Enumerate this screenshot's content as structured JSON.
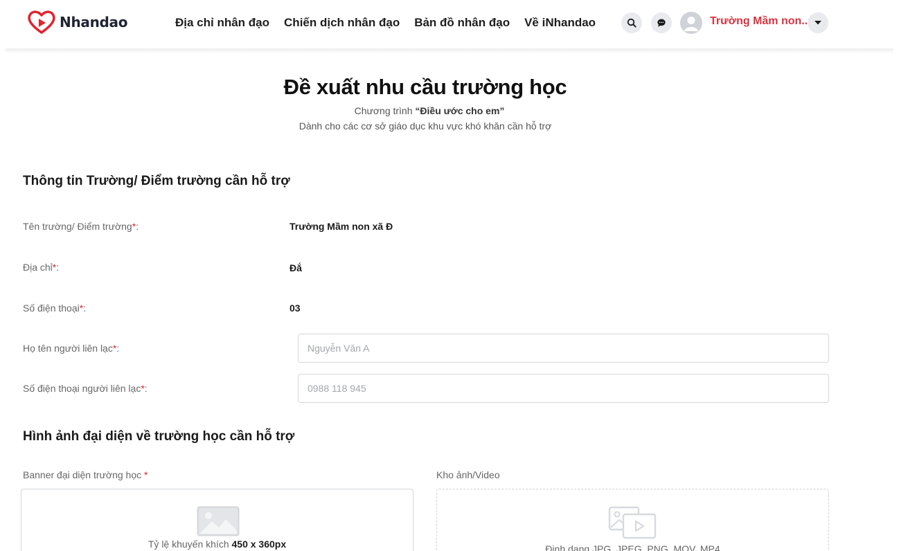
{
  "brand": {
    "name": "Nhandao",
    "logo_color": "#e0242f"
  },
  "nav": [
    {
      "label": "Địa chỉ nhân đạo"
    },
    {
      "label": "Chiến dịch nhân đạo"
    },
    {
      "label": "Bản đồ nhân đạo"
    },
    {
      "label": "Về iNhandao"
    }
  ],
  "user": {
    "name": "Trường Mầm non...",
    "name_color": "#d8323f"
  },
  "icons": {
    "search": "search-icon",
    "chat": "chat-icon",
    "avatar": "user-avatar-icon",
    "dropdown": "caret-down-icon"
  },
  "page": {
    "title": "Đề xuất nhu cầu trường học",
    "subtitle_prefix": "Chương trình ",
    "subtitle_program": "“Điều ước cho em”",
    "subtitle2": "Dành cho các cơ sở giáo dục khu vực khó khăn cần hỗ trợ"
  },
  "section_info": {
    "title": "Thông tin Trường/ Điểm trường cần hỗ trợ",
    "school_name_label": "Tên trường/ Điểm trường",
    "school_name_value": "Trường Mầm non xã Đ",
    "address_label": "Địa chỉ",
    "address_value": "Đắ",
    "phone_label": "Số điện thoại",
    "phone_value": "03",
    "contact_name_label": "Họ tên người liên lạc",
    "contact_name_placeholder": "Nguyễn Văn A",
    "contact_phone_label": "Số điện thoại người liên lạc",
    "contact_phone_placeholder": "0988 118 945",
    "required_mark": "*"
  },
  "section_images": {
    "title": "Hình ảnh đại diện về trường học cần hỗ trợ",
    "banner_label": "Banner đại diện trường học",
    "banner_required": " *",
    "banner_hint_prefix": "Tỷ lệ khuyến khích ",
    "banner_hint_size": "450 x 360px",
    "gallery_label": "Kho ảnh/Video",
    "gallery_hint": "Định dạng JPG, JPEG, PNG, MOV, MP4"
  }
}
